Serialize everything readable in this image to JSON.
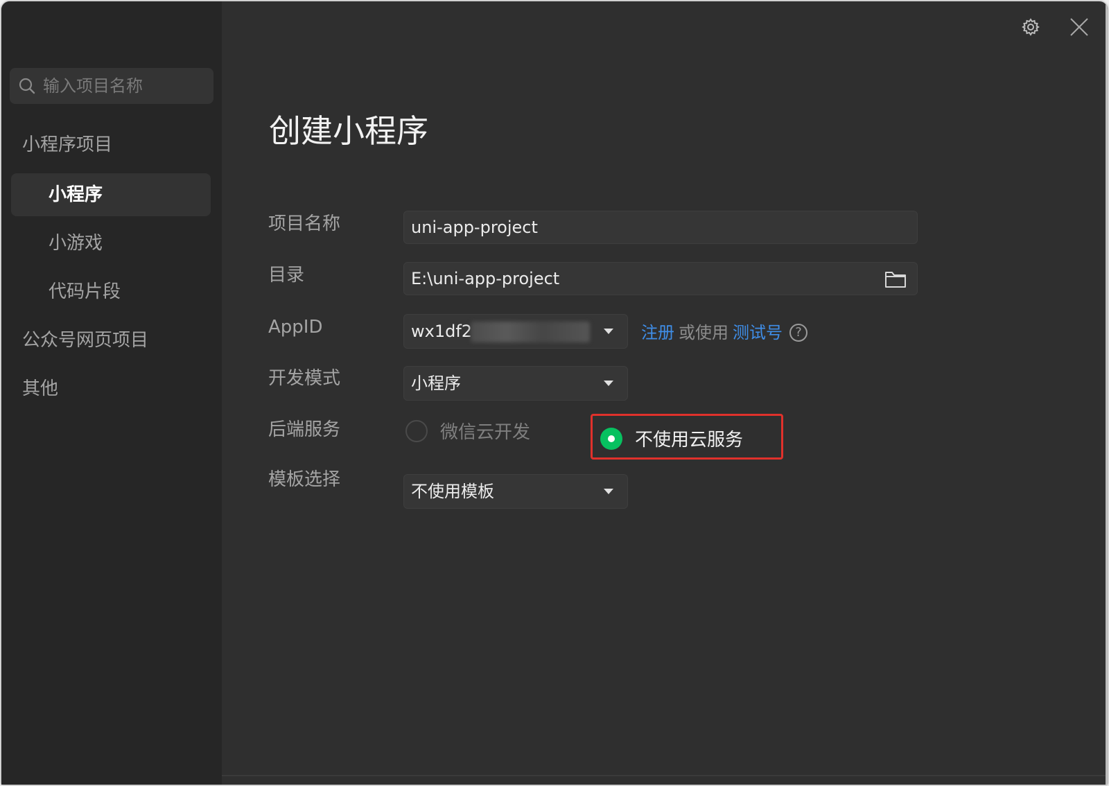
{
  "search": {
    "placeholder": "输入项目名称"
  },
  "sidebar": {
    "groups": [
      {
        "label": "小程序项目"
      },
      {
        "label": "公众号网页项目"
      },
      {
        "label": "其他"
      }
    ],
    "items": [
      {
        "label": "小程序",
        "active": true
      },
      {
        "label": "小游戏",
        "active": false
      },
      {
        "label": "代码片段",
        "active": false
      }
    ]
  },
  "topbar": {
    "settings_icon": "gear-icon",
    "close_icon": "close-icon"
  },
  "page": {
    "title": "创建小程序"
  },
  "form": {
    "project_name": {
      "label": "项目名称",
      "value": "uni-app-project"
    },
    "directory": {
      "label": "目录",
      "value": "E:\\uni-app-project",
      "browse_icon": "folder-icon"
    },
    "appid": {
      "label": "AppID",
      "value_visible": "wx1df2",
      "register_link": "注册",
      "or_use": "或使用",
      "test_account_link": "测试号",
      "help_icon_text": "?"
    },
    "dev_mode": {
      "label": "开发模式",
      "selected": "小程序"
    },
    "backend": {
      "label": "后端服务",
      "options": [
        {
          "label": "微信云开发",
          "selected": false
        },
        {
          "label": "不使用云服务",
          "selected": true
        }
      ]
    },
    "template": {
      "label": "模板选择",
      "selected": "不使用模板"
    }
  },
  "colors": {
    "sidebar_bg": "#262626",
    "content_bg": "#2f2f2f",
    "accent_green": "#07c160",
    "link_blue": "#3f8ee8",
    "highlight_red": "#e0312b"
  }
}
